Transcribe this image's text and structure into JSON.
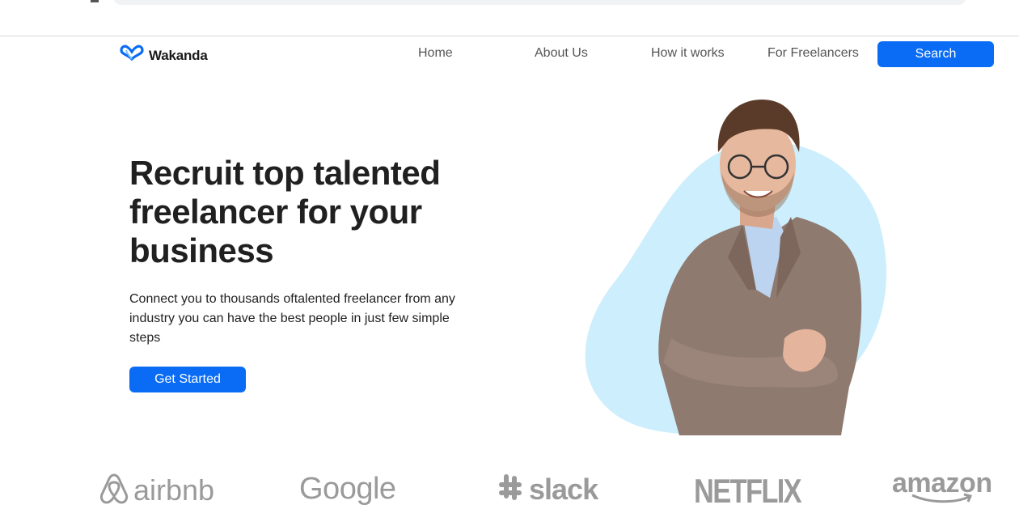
{
  "brand": {
    "name": "Wakanda",
    "accent": "#0a6cf5"
  },
  "nav": {
    "items": [
      {
        "label": "Home"
      },
      {
        "label": "About Us"
      },
      {
        "label": "How it works"
      },
      {
        "label": "For Freelancers"
      }
    ],
    "search_label": "Search"
  },
  "hero": {
    "title": "Recruit top talented freelancer for your business",
    "subtitle": "Connect you to thousands oftalented freelancer from any industry you can have the best people in just few simple steps",
    "cta_label": "Get Started",
    "blob_color": "#cdeefc"
  },
  "partners": [
    {
      "name": "airbnb"
    },
    {
      "name": "Google"
    },
    {
      "name": "slack"
    },
    {
      "name": "NETFLIX"
    },
    {
      "name": "amazon"
    }
  ]
}
